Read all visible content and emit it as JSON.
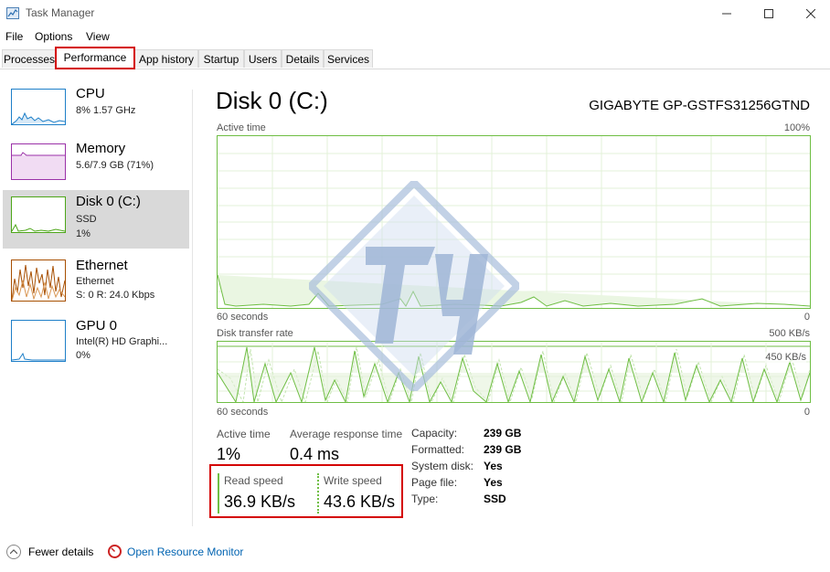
{
  "window": {
    "title": "Task Manager"
  },
  "menu": [
    "File",
    "Options",
    "View"
  ],
  "tabs": [
    "Processes",
    "Performance",
    "App history",
    "Startup",
    "Users",
    "Details",
    "Services"
  ],
  "sidebar": [
    {
      "title": "CPU",
      "line1": "8%  1.57 GHz",
      "color": "#1e7fc8"
    },
    {
      "title": "Memory",
      "line1": "5.6/7.9 GB (71%)",
      "color": "#9b31a8"
    },
    {
      "title": "Disk 0 (C:)",
      "line1": "SSD",
      "line2": "1%",
      "color": "#4da619"
    },
    {
      "title": "Ethernet",
      "line1": "Ethernet",
      "line2": "S: 0 R: 24.0 Kbps",
      "color": "#a74f01"
    },
    {
      "title": "GPU 0",
      "line1": "Intel(R) HD Graphi...",
      "line2": "0%",
      "color": "#1e7fc8"
    }
  ],
  "main": {
    "title": "Disk 0 (C:)",
    "model": "GIGABYTE GP-GSTFS31256GTND",
    "chart1": {
      "label": "Active time",
      "max": "100%",
      "time": "60 seconds",
      "min": "0"
    },
    "chart2": {
      "label": "Disk transfer rate",
      "max": "500 KB/s",
      "mid": "450 KB/s",
      "time": "60 seconds",
      "min": "0"
    },
    "stats": {
      "active_time_label": "Active time",
      "active_time_value": "1%",
      "response_label": "Average response time",
      "response_value": "0.4 ms",
      "read_label": "Read speed",
      "read_value": "36.9 KB/s",
      "write_label": "Write speed",
      "write_value": "43.6 KB/s"
    },
    "info": [
      {
        "label": "Capacity:",
        "value": "239 GB"
      },
      {
        "label": "Formatted:",
        "value": "239 GB"
      },
      {
        "label": "System disk:",
        "value": "Yes"
      },
      {
        "label": "Page file:",
        "value": "Yes"
      },
      {
        "label": "Type:",
        "value": "SSD"
      }
    ]
  },
  "footer": {
    "fewer_details": "Fewer details",
    "resource_monitor": "Open Resource Monitor"
  },
  "colors": {
    "disk_green": "#6fbe44",
    "highlight_red": "#d40000",
    "link_blue": "#0063b1"
  }
}
